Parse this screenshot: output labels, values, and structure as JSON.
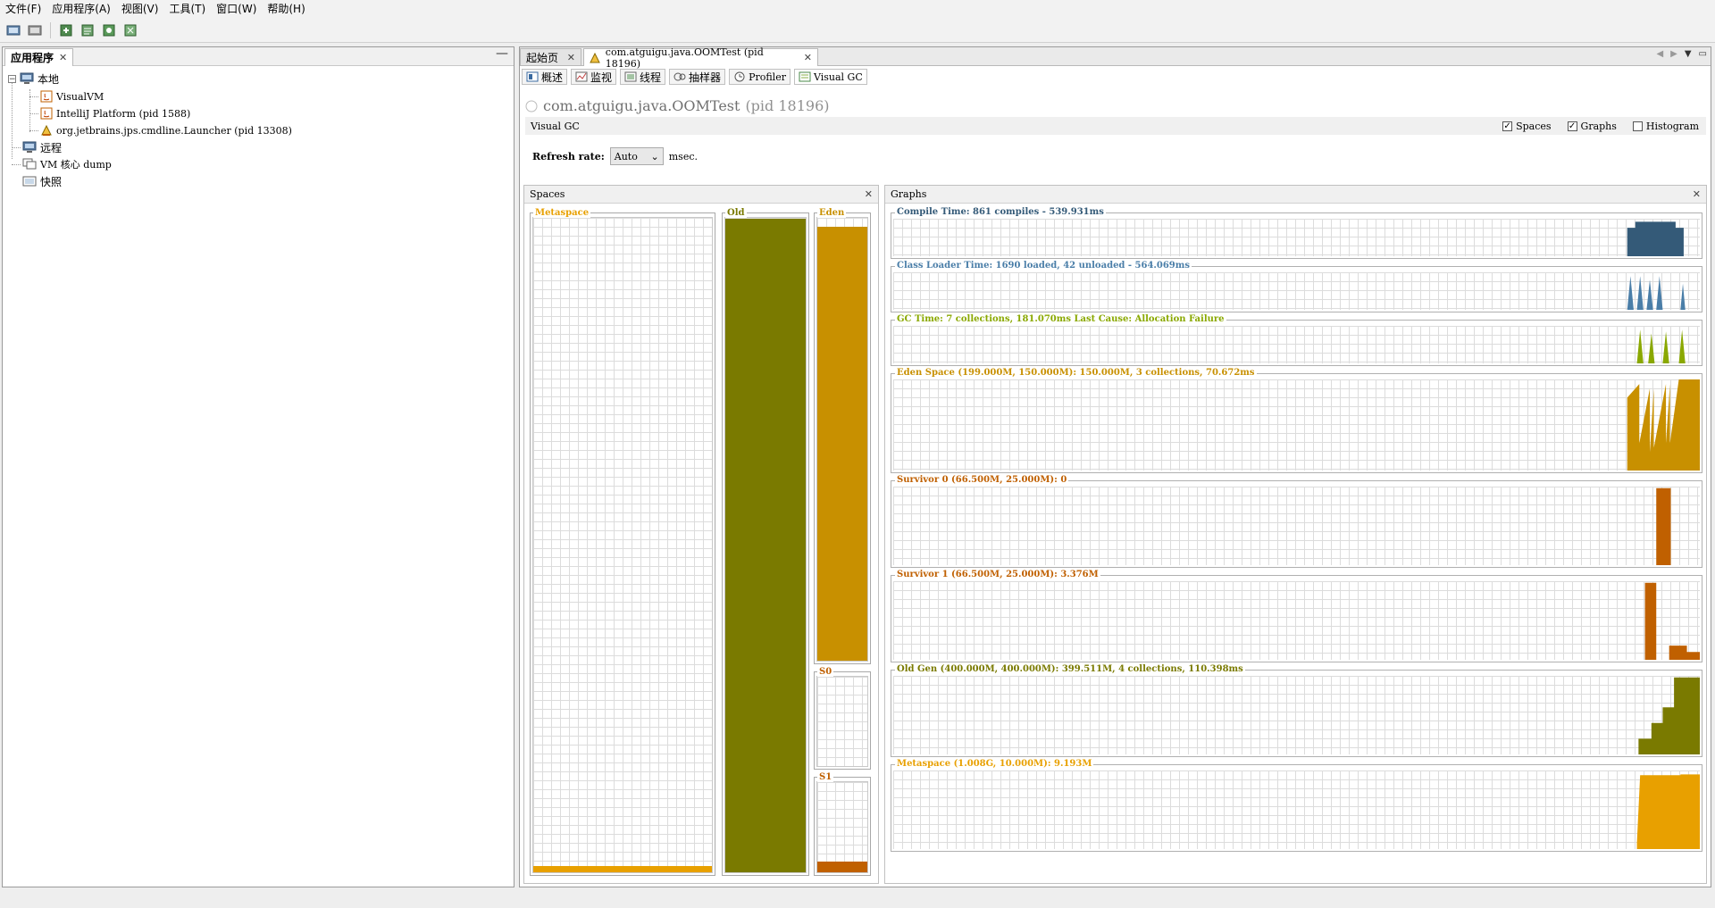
{
  "menubar": {
    "items": [
      "文件(F)",
      "应用程序(A)",
      "视图(V)",
      "工具(T)",
      "窗口(W)",
      "帮助(H)"
    ]
  },
  "toolbar": {
    "icons": [
      "add-jmx-icon",
      "add-remote-host-icon",
      "add-heap-dump-icon",
      "add-thread-dump-icon",
      "add-snapshot-icon",
      "add-core-dump-icon"
    ]
  },
  "left": {
    "tab_label": "应用程序",
    "tree": {
      "local": "本地",
      "local_children": [
        "VisualVM",
        "IntelliJ Platform (pid 1588)",
        "org.jetbrains.jps.cmdline.Launcher (pid 13308)"
      ],
      "remote": "远程",
      "core_dump": "VM 核心 dump",
      "snapshots": "快照"
    }
  },
  "doc_tabs": [
    {
      "label": "起始页"
    },
    {
      "label": "com.atguigu.java.OOMTest (pid 18196)"
    }
  ],
  "sub_tabs": [
    "概述",
    "监视",
    "线程",
    "抽样器",
    "Profiler",
    "Visual GC"
  ],
  "process": {
    "name": "com.atguigu.java.OOMTest",
    "pid": "(pid 18196)"
  },
  "visual_gc": {
    "label": "Visual GC",
    "spaces_cb": "Spaces",
    "graphs_cb": "Graphs",
    "histogram_cb": "Histogram",
    "spaces_checked": true,
    "graphs_checked": true,
    "histogram_checked": false,
    "refresh_label": "Refresh rate:",
    "refresh_value": "Auto",
    "refresh_unit": "msec."
  },
  "spaces": {
    "title": "Spaces",
    "metaspace": {
      "label": "Metaspace",
      "fill": 0.009,
      "color": "#e8a000"
    },
    "old": {
      "label": "Old",
      "fill": 0.999,
      "color": "#7a7a00"
    },
    "eden": {
      "label": "Eden",
      "fill": 0.98,
      "color": "#c89000"
    },
    "s0": {
      "label": "S0",
      "fill": 0.0,
      "color": "#c06000"
    },
    "s1": {
      "label": "S1",
      "fill": 0.12,
      "color": "#c06000"
    }
  },
  "graphs": {
    "title": "Graphs",
    "items": [
      {
        "title": "Compile Time: 861 compiles - 539.931ms",
        "color": "#345a78"
      },
      {
        "title": "Class Loader Time: 1690 loaded, 42 unloaded - 564.069ms",
        "color": "#4a7ea8"
      },
      {
        "title": "GC Time: 7 collections, 181.070ms Last Cause: Allocation Failure",
        "color": "#8aa800"
      },
      {
        "title": "Eden Space (199.000M, 150.000M): 150.000M, 3 collections, 70.672ms",
        "color": "#c89000"
      },
      {
        "title": "Survivor 0 (66.500M, 25.000M): 0",
        "color": "#c06000"
      },
      {
        "title": "Survivor 1 (66.500M, 25.000M): 3.376M",
        "color": "#c06000"
      },
      {
        "title": "Old Gen (400.000M, 400.000M): 399.511M, 4 collections, 110.398ms",
        "color": "#7a7a00"
      },
      {
        "title": "Metaspace (1.008G, 10.000M): 9.193M",
        "color": "#e8a000"
      }
    ]
  }
}
